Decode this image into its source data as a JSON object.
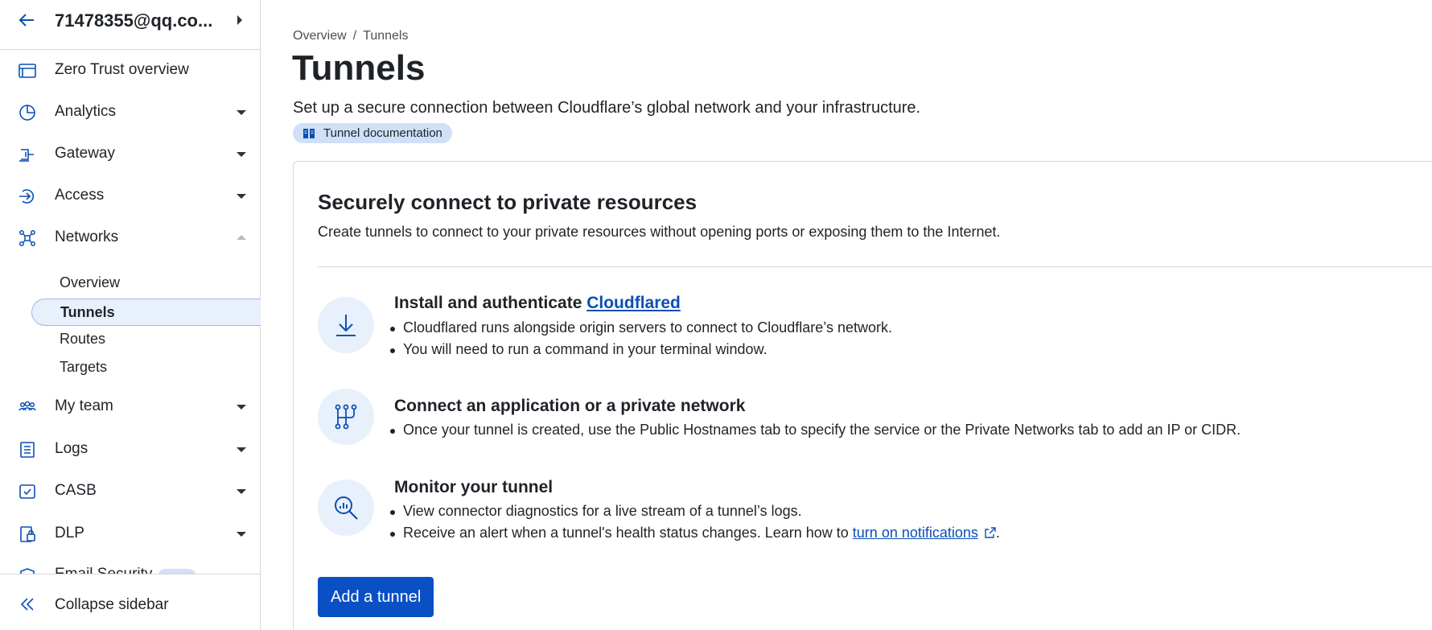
{
  "account": {
    "email": "71478355@qq.co..."
  },
  "sidebar": {
    "items": [
      {
        "label": "Zero Trust overview",
        "icon": "browser-window-icon"
      },
      {
        "label": "Analytics",
        "icon": "pie-chart-icon"
      },
      {
        "label": "Gateway",
        "icon": "gateway-icon"
      },
      {
        "label": "Access",
        "icon": "access-icon"
      },
      {
        "label": "Networks",
        "icon": "network-icon"
      },
      {
        "label": "My team",
        "icon": "team-icon"
      },
      {
        "label": "Logs",
        "icon": "logs-icon"
      },
      {
        "label": "CASB",
        "icon": "casb-icon"
      },
      {
        "label": "DLP",
        "icon": "dlp-icon"
      }
    ],
    "networks_sub": [
      {
        "label": "Overview"
      },
      {
        "label": "Tunnels",
        "active": true
      },
      {
        "label": "Routes"
      },
      {
        "label": "Targets"
      }
    ],
    "clipped_item": {
      "label": "Email Security",
      "badge": "New"
    },
    "collapse_label": "Collapse sidebar"
  },
  "breadcrumb": {
    "parent": "Overview",
    "separator": "/",
    "current": "Tunnels"
  },
  "page": {
    "title": "Tunnels",
    "subtitle": "Set up a secure connection between Cloudflare’s global network and your infrastructure.",
    "doc_link": "Tunnel documentation"
  },
  "card": {
    "title": "Securely connect to private resources",
    "description": "Create tunnels to connect to your private resources without opening ports or exposing them to the Internet.",
    "steps": [
      {
        "title": "Install and authenticate ",
        "title_link": "Cloudflared",
        "icon": "download-icon",
        "bullets": [
          "Cloudflared runs alongside origin servers to connect to Cloudflare’s network.",
          "You will need to run a command in your terminal window."
        ]
      },
      {
        "title": "Connect an application or a private network",
        "icon": "branch-network-icon",
        "bullets": [
          "Once your tunnel is created, use the Public Hostnames tab to specify the service or the Private Networks tab to add an IP or CIDR."
        ]
      },
      {
        "title": "Monitor your tunnel",
        "icon": "search-analytics-icon",
        "bullets": [
          "View connector diagnostics for a live stream of a tunnel’s logs.",
          "Receive an alert when a tunnel's health status changes. Learn how to "
        ],
        "bullet_link": "turn on notifications",
        "bullet_suffix": "."
      }
    ],
    "add_button": "Add a tunnel"
  },
  "colors": {
    "accent": "#0b4fc4",
    "link": "#0b4fb5",
    "active_bg": "#e8f0fb",
    "pill_bg": "#cfe0f7"
  }
}
